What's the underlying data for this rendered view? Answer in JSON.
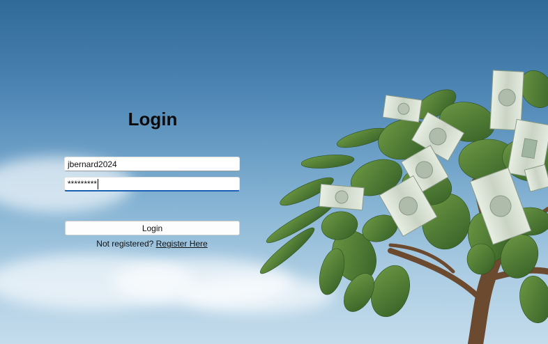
{
  "login": {
    "title": "Login",
    "username_value": "jbernard2024",
    "password_value": "*********",
    "button_label": "Login",
    "register_prompt": "Not registered?",
    "register_link": "Register Here"
  },
  "background": {
    "sky_color": "#4f87b6",
    "leaf_color": "#4e7a35",
    "trunk_color": "#6b4a2f",
    "banknote_color": "#d9e2d3"
  }
}
